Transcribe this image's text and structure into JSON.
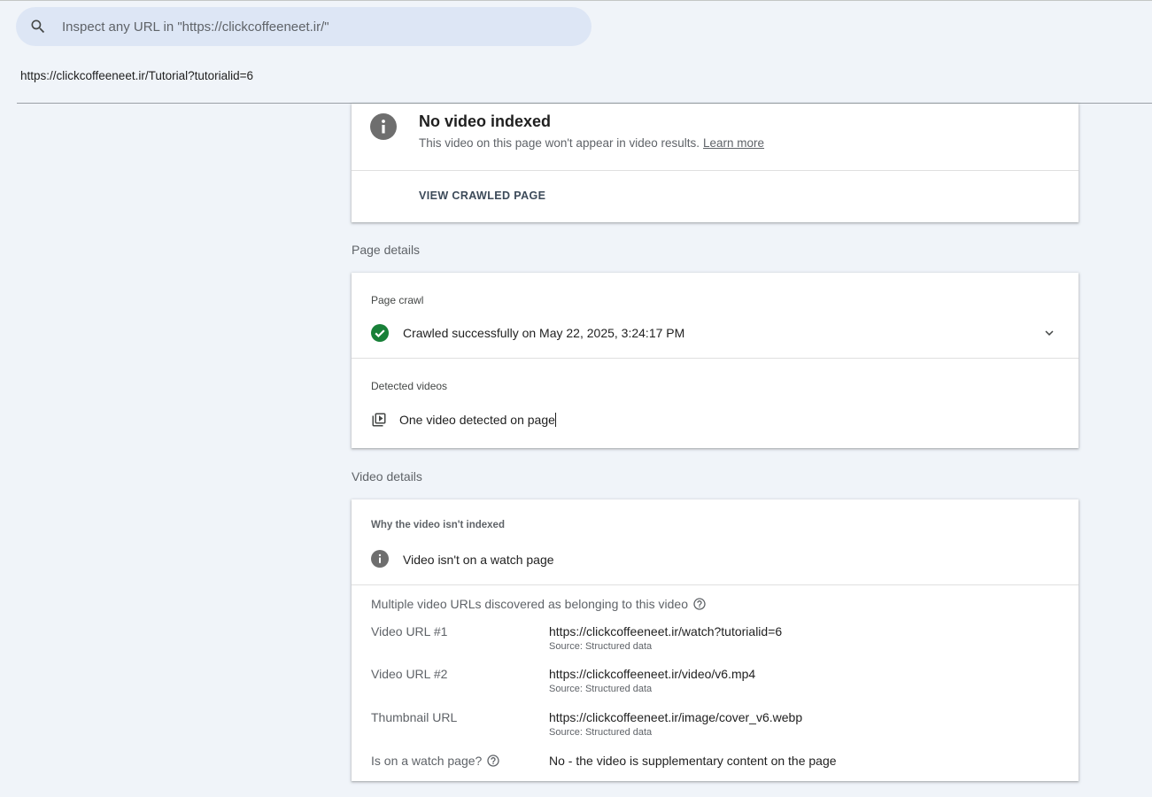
{
  "search": {
    "placeholder": "Inspect any URL in \"https://clickcoffeeneet.ir/\"",
    "value": ""
  },
  "inspected_url": "https://clickcoffeeneet.ir/Tutorial?tutorialid=6",
  "status_card": {
    "title": "No video indexed",
    "description": "This video on this page won't appear in video results.",
    "learn_more": "Learn more",
    "view_crawled": "VIEW CRAWLED PAGE"
  },
  "page_details": {
    "heading": "Page details",
    "page_crawl_label": "Page crawl",
    "crawl_status": "Crawled successfully on May 22, 2025, 3:24:17 PM",
    "detected_videos_label": "Detected videos",
    "detected_videos_text": "One video detected on page"
  },
  "video_details": {
    "heading": "Video details",
    "why_label": "Why the video isn't indexed",
    "reason": "Video isn't on a watch page",
    "multi_heading": "Multiple video URLs discovered as belonging to this video",
    "rows": [
      {
        "label": "Video URL #1",
        "value": "https://clickcoffeeneet.ir/watch?tutorialid=6",
        "source": "Source: Structured data"
      },
      {
        "label": "Video URL #2",
        "value": "https://clickcoffeeneet.ir/video/v6.mp4",
        "source": "Source: Structured data"
      },
      {
        "label": "Thumbnail URL",
        "value": "https://clickcoffeeneet.ir/image/cover_v6.webp",
        "source": "Source: Structured data"
      }
    ],
    "watch_page_label": "Is on a watch page?",
    "watch_page_value": "No - the video is supplementary content on the page"
  },
  "colors": {
    "page_background": "#f0f4f9",
    "search_background": "#dde6f5",
    "success_green": "#188038",
    "info_gray": "#6e6e6e"
  },
  "icons": [
    "search-icon",
    "info-icon",
    "check-circle-icon",
    "chevron-down-icon",
    "video-library-icon",
    "help-circle-icon"
  ]
}
